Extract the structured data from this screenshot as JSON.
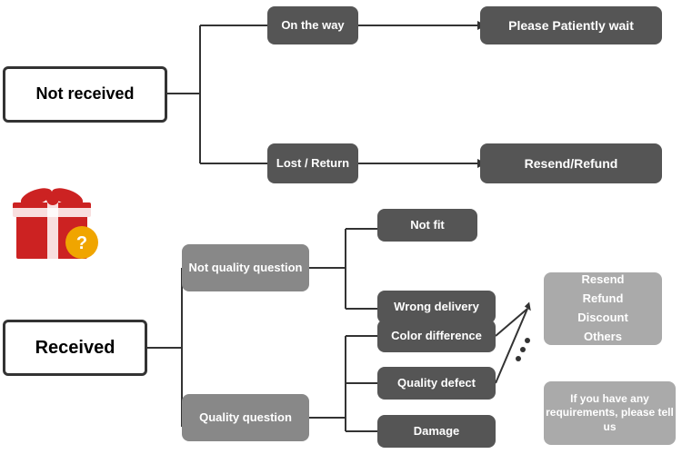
{
  "boxes": {
    "not_received": {
      "label": "Not received"
    },
    "on_the_way": {
      "label": "On the way"
    },
    "please_wait": {
      "label": "Please Patiently wait"
    },
    "lost_return": {
      "label": "Lost / Return"
    },
    "resend_refund_top": {
      "label": "Resend/Refund"
    },
    "received": {
      "label": "Received"
    },
    "not_quality": {
      "label": "Not quality question"
    },
    "quality_question": {
      "label": "Quality question"
    },
    "not_fit": {
      "label": "Not fit"
    },
    "wrong_delivery": {
      "label": "Wrong delivery"
    },
    "color_difference": {
      "label": "Color difference"
    },
    "quality_defect": {
      "label": "Quality defect"
    },
    "damage": {
      "label": "Damage"
    },
    "resend_options": {
      "label": "Resend\nRefund\nDiscount\nOthers"
    },
    "requirements": {
      "label": "If you have any requirements, please tell us"
    }
  }
}
